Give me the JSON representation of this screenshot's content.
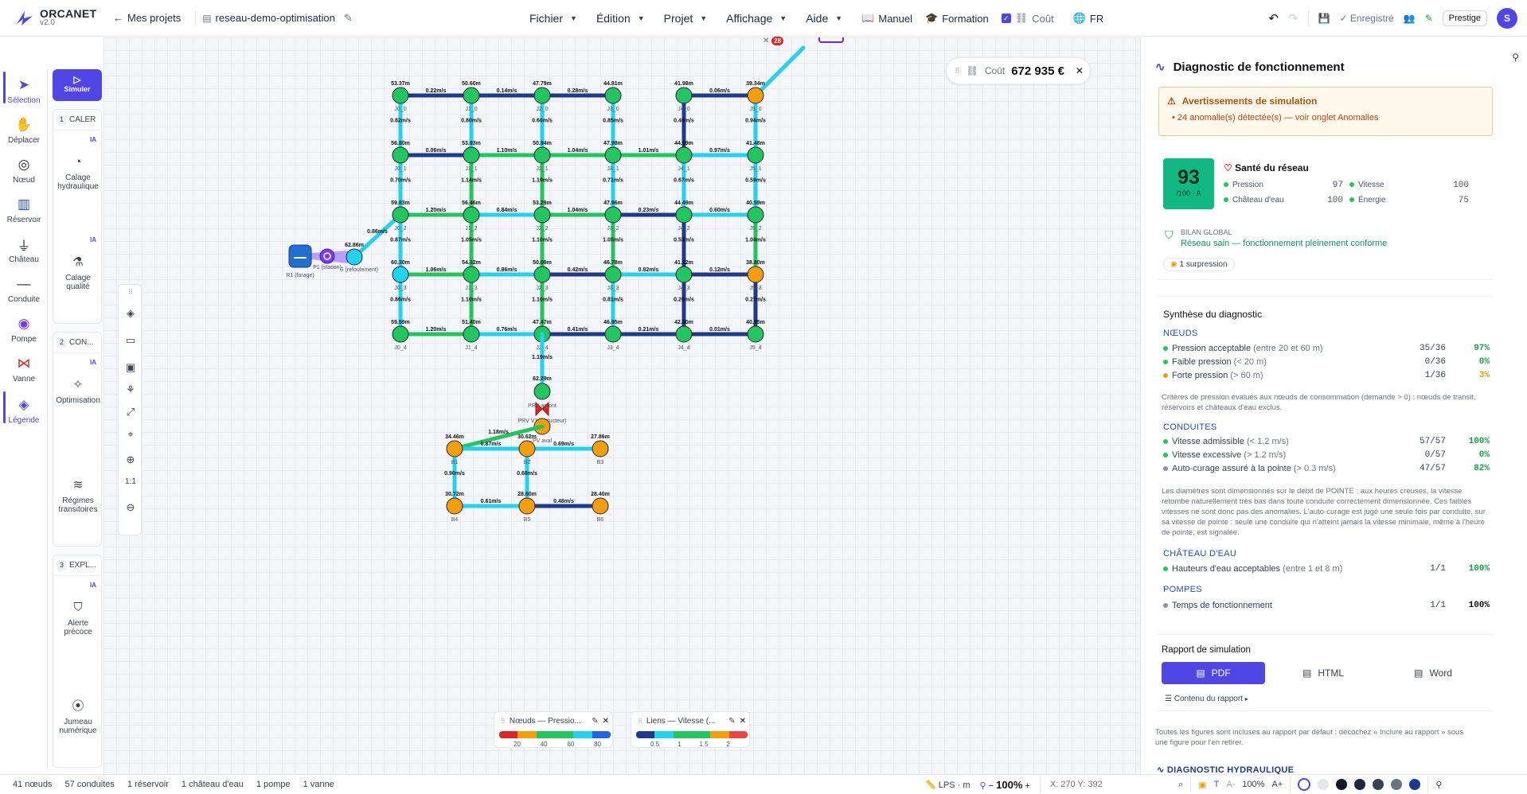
{
  "app": {
    "name": "ORCANET",
    "version": "v2.0",
    "back": "Mes projets",
    "project": "reseau-demo-optimisation"
  },
  "menus": [
    "Fichier",
    "Édition",
    "Projet",
    "Affichage",
    "Aide"
  ],
  "top_links": {
    "manual": "Manuel",
    "training": "Formation",
    "cost": "Coût",
    "lang": "FR"
  },
  "top_right": {
    "saved": "Enregistré",
    "plan": "Prestige",
    "avatar": "S"
  },
  "left_tools": [
    {
      "label": "Sélection",
      "icon": "cursor-icon"
    },
    {
      "label": "Déplacer",
      "icon": "hand-icon"
    },
    {
      "label": "Nœud",
      "icon": "node-icon"
    },
    {
      "label": "Réservoir",
      "icon": "reservoir-icon"
    },
    {
      "label": "Château",
      "icon": "tower-icon"
    },
    {
      "label": "Conduite",
      "icon": "pipe-icon"
    },
    {
      "label": "Pompe",
      "icon": "pump-icon"
    },
    {
      "label": "Vanne",
      "icon": "valve-icon"
    },
    {
      "label": "Légende",
      "icon": "layers-icon"
    }
  ],
  "workflow": {
    "simulate": "Simuler",
    "ia": "IA",
    "steps": [
      {
        "num": "1",
        "title": "CALER",
        "tools": [
          "Calage hydraulique",
          "Calage qualité"
        ]
      },
      {
        "num": "2",
        "title": "CON...",
        "tools": [
          "Optimisation",
          "Régimes transitoires"
        ]
      },
      {
        "num": "3",
        "title": "EXPL...",
        "tools": [
          "Alerte précoce",
          "Jumeau numérique"
        ]
      }
    ]
  },
  "canvas": {
    "cost_label": "Coût",
    "cost_value": "672 935 €",
    "badge": "28",
    "zoom_fit": "1:1"
  },
  "network": {
    "cols": [
      "0",
      "1",
      "2",
      "3",
      "4",
      "5"
    ],
    "rows": [
      "0",
      "1",
      "2",
      "3",
      "4"
    ],
    "pressures": [
      [
        "53.37m",
        "50.60m",
        "47.79m",
        "44.81m",
        "41.98m",
        "39.34m"
      ],
      [
        "56.80m",
        "53.93m",
        "50.94m",
        "47.98m",
        "44.99m",
        "41.48m"
      ],
      [
        "59.83m",
        "56.46m",
        "53.29m",
        "47.96m",
        "44.49m",
        "40.59m"
      ],
      [
        "60.30m",
        "54.32m",
        "50.09m",
        "46.78m",
        "41.02m",
        "38.80m"
      ],
      [
        "59.59m",
        "51.40m",
        "47.47m",
        "46.95m",
        "42.00m",
        "40.95m"
      ]
    ],
    "node_status": [
      [
        "g",
        "g",
        "g",
        "g",
        "g",
        "o"
      ],
      [
        "g",
        "g",
        "g",
        "g",
        "g",
        "g"
      ],
      [
        "g",
        "g",
        "g",
        "g",
        "g",
        "g"
      ],
      [
        "c",
        "g",
        "g",
        "g",
        "g",
        "o"
      ],
      [
        "g",
        "g",
        "g",
        "g",
        "g",
        "g"
      ]
    ],
    "h_links": [
      [
        [
          "0.22m/s",
          "n"
        ],
        [
          "0.14m/s",
          "n"
        ],
        [
          "0.28m/s",
          "n"
        ],
        null,
        [
          "0.06m/s",
          "n"
        ]
      ],
      [
        [
          "0.06m/s",
          "n"
        ],
        [
          "1.10m/s",
          "g"
        ],
        [
          "1.04m/s",
          "g"
        ],
        [
          "1.01m/s",
          "g"
        ],
        [
          "0.97m/s",
          "c"
        ]
      ],
      [
        [
          "1.20m/s",
          "g"
        ],
        [
          "0.84m/s",
          "c"
        ],
        [
          "1.04m/s",
          "g"
        ],
        [
          "0.23m/s",
          "n"
        ],
        [
          "0.60m/s",
          "c"
        ]
      ],
      [
        [
          "1.06m/s",
          "g"
        ],
        [
          "0.86m/s",
          "c"
        ],
        [
          "0.42m/s",
          "n"
        ],
        [
          "0.82m/s",
          "c"
        ],
        [
          "0.12m/s",
          "n"
        ]
      ],
      [
        [
          "1.20m/s",
          "g"
        ],
        [
          "0.76m/s",
          "c"
        ],
        [
          "0.41m/s",
          "n"
        ],
        [
          "0.21m/s",
          "n"
        ],
        [
          "0.01m/s",
          "n"
        ]
      ]
    ],
    "v_links": [
      [
        [
          "0.82m/s",
          "c"
        ],
        [
          "0.80m/s",
          "c"
        ],
        [
          "0.60m/s",
          "c"
        ],
        [
          "0.85m/s",
          "c"
        ],
        [
          "0.40m/s",
          "n"
        ],
        [
          "0.94m/s",
          "c"
        ]
      ],
      [
        [
          "0.70m/s",
          "c"
        ],
        [
          "1.14m/s",
          "g"
        ],
        [
          "1.19m/s",
          "g"
        ],
        [
          "0.71m/s",
          "c"
        ],
        [
          "0.67m/s",
          "c"
        ],
        [
          "0.59m/s",
          "c"
        ]
      ],
      [
        [
          "0.87m/s",
          "c"
        ],
        [
          "1.05m/s",
          "g"
        ],
        [
          "1.10m/s",
          "g"
        ],
        [
          "1.05m/s",
          "g"
        ],
        [
          "0.53m/s",
          "n"
        ],
        [
          "1.04m/s",
          "g"
        ]
      ],
      [
        [
          "0.86m/s",
          "c"
        ],
        [
          "1.10m/s",
          "g"
        ],
        [
          "1.10m/s",
          "g"
        ],
        [
          "0.81m/s",
          "c"
        ],
        [
          "0.20m/s",
          "n"
        ],
        [
          "0.27m/s",
          "n"
        ]
      ]
    ],
    "reservoir": "R1 (forage)",
    "pump": "P1 (station)",
    "pump_node": "S (refoulement)",
    "pump_node_p": "62.86m",
    "pump_link": "0.86m/s",
    "prv_label": "PRV V1 (réducteur)",
    "prv_up": "PRV amont",
    "prv_down": "PV aval",
    "prv_up_p": "62.29m",
    "prv_link": "1.19m/s",
    "lower_nodes": [
      {
        "name": "B1",
        "p": "34.46m"
      },
      {
        "name": "B2",
        "p": "30.62m"
      },
      {
        "name": "B3",
        "p": "27.86m"
      },
      {
        "name": "B4",
        "p": "30.72m"
      },
      {
        "name": "B5",
        "p": "28.60m"
      },
      {
        "name": "B6",
        "p": "28.40m"
      }
    ],
    "lower_links": {
      "prv_b1": "1.18m/s",
      "b1_b2": "0.87m/s",
      "b2_b3": "0.69m/s",
      "b1_b4": "0.90m/s",
      "b2_b5": "0.68m/s",
      "b4_b5": "0.61m/s",
      "b5_b6": "0.48m/s"
    }
  },
  "legends": {
    "nodes": {
      "title": "Nœuds — Pressio...",
      "ticks": [
        "20",
        "40",
        "60",
        "80"
      ]
    },
    "links": {
      "title": "Liens — Vitesse (...",
      "ticks": [
        "0.5",
        "1",
        "1.5",
        "2"
      ]
    }
  },
  "colors": {
    "accent": "#4f46e5",
    "green": "#22c55e",
    "cyan": "#22d3ee",
    "navy": "#1e3a8a",
    "orange": "#f59e0b",
    "grid": "#e6e9f0"
  },
  "panel": {
    "title": "Diagnostic de fonctionnement",
    "warn_title": "Avertissements de simulation",
    "warn_text": "24 anomalie(s) détectée(s) — voir onglet Anomalies",
    "score": "93",
    "score_sub": "/100 · A",
    "health_title": "Santé du réseau",
    "health": [
      {
        "label": "Pression",
        "value": "97"
      },
      {
        "label": "Vitesse",
        "value": "100"
      },
      {
        "label": "Château d'eau",
        "value": "100"
      },
      {
        "label": "Énergie",
        "value": "75"
      }
    ],
    "bilan_title": "BILAN GLOBAL",
    "bilan_text": "Réseau sain — fonctionnement pleinement conforme",
    "suppression": "1 surpression",
    "synth_title": "Synthèse du diagnostic",
    "nodes_title": "NŒUDS",
    "nodes": [
      {
        "label": "Pression acceptable",
        "hint": "(entre 20 et 60 m)",
        "count": "35/36",
        "pct": "97%",
        "color": "#22c55e"
      },
      {
        "label": "Faible pression",
        "hint": "(< 20 m)",
        "count": "0/36",
        "pct": "0%",
        "color": "#22c55e"
      },
      {
        "label": "Forte pression",
        "hint": "(> 60 m)",
        "count": "1/36",
        "pct": "3%",
        "color": "#f59e0b"
      }
    ],
    "nodes_note": "Critères de pression évalués aux nœuds de consommation (demande > 0) : nœuds de transit, réservoirs et châteaux d'eau exclus.",
    "pipes_title": "CONDUITES",
    "pipes": [
      {
        "label": "Vitesse admissible",
        "hint": "(< 1.2 m/s)",
        "count": "57/57",
        "pct": "100%",
        "color": "#22c55e"
      },
      {
        "label": "Vitesse excessive",
        "hint": "(> 1.2 m/s)",
        "count": "0/57",
        "pct": "0%",
        "color": "#22c55e"
      },
      {
        "label": "Auto-curage assuré à la pointe",
        "hint": "(> 0.3 m/s)",
        "count": "47/57",
        "pct": "82%",
        "color": "#8b8fa3"
      }
    ],
    "pipes_note": "Les diamètres sont dimensionnés sur le débit de POINTE : aux heures creuses, la vitesse retombe naturellement très bas dans toute conduite correctement dimensionnée. Ces faibles vitesses ne sont donc pas des anomalies. L'auto-curage est jugé une seule fois par conduite, sur sa vitesse de pointe : seule une conduite qui n'atteint jamais la vitesse minimale, même à l'heure de pointe, est signalée.",
    "tower_title": "CHÂTEAU D'EAU",
    "tower": [
      {
        "label": "Hauteurs d'eau acceptables",
        "hint": "(entre 1 et 8 m)",
        "count": "1/1",
        "pct": "100%",
        "color": "#22c55e"
      }
    ],
    "pumps_title": "POMPES",
    "pumps": [
      {
        "label": "Temps de fonctionnement",
        "hint": "",
        "count": "1/1",
        "pct": "100%",
        "color": "#8b8fa3"
      }
    ],
    "report_title": "Rapport de simulation",
    "report_buttons": [
      "PDF",
      "HTML",
      "Word"
    ],
    "report_content": "Contenu du rapport",
    "report_note": "Toutes les figures sont incluses au rapport par défaut : décochez « Inclure au rapport » sous une figure pour l'en retirer.",
    "next_section": "DIAGNOSTIC HYDRAULIQUE"
  },
  "status": {
    "nodes": "41 nœuds",
    "pipes": "57 conduites",
    "reservoir": "1 réservoir",
    "tower": "1 château d'eau",
    "pump": "1 pompe",
    "valve": "1 vanne",
    "units": "LPS · m",
    "zoom": "100%",
    "coords": "X: 270 Y: 392",
    "zoom2": "100%"
  }
}
